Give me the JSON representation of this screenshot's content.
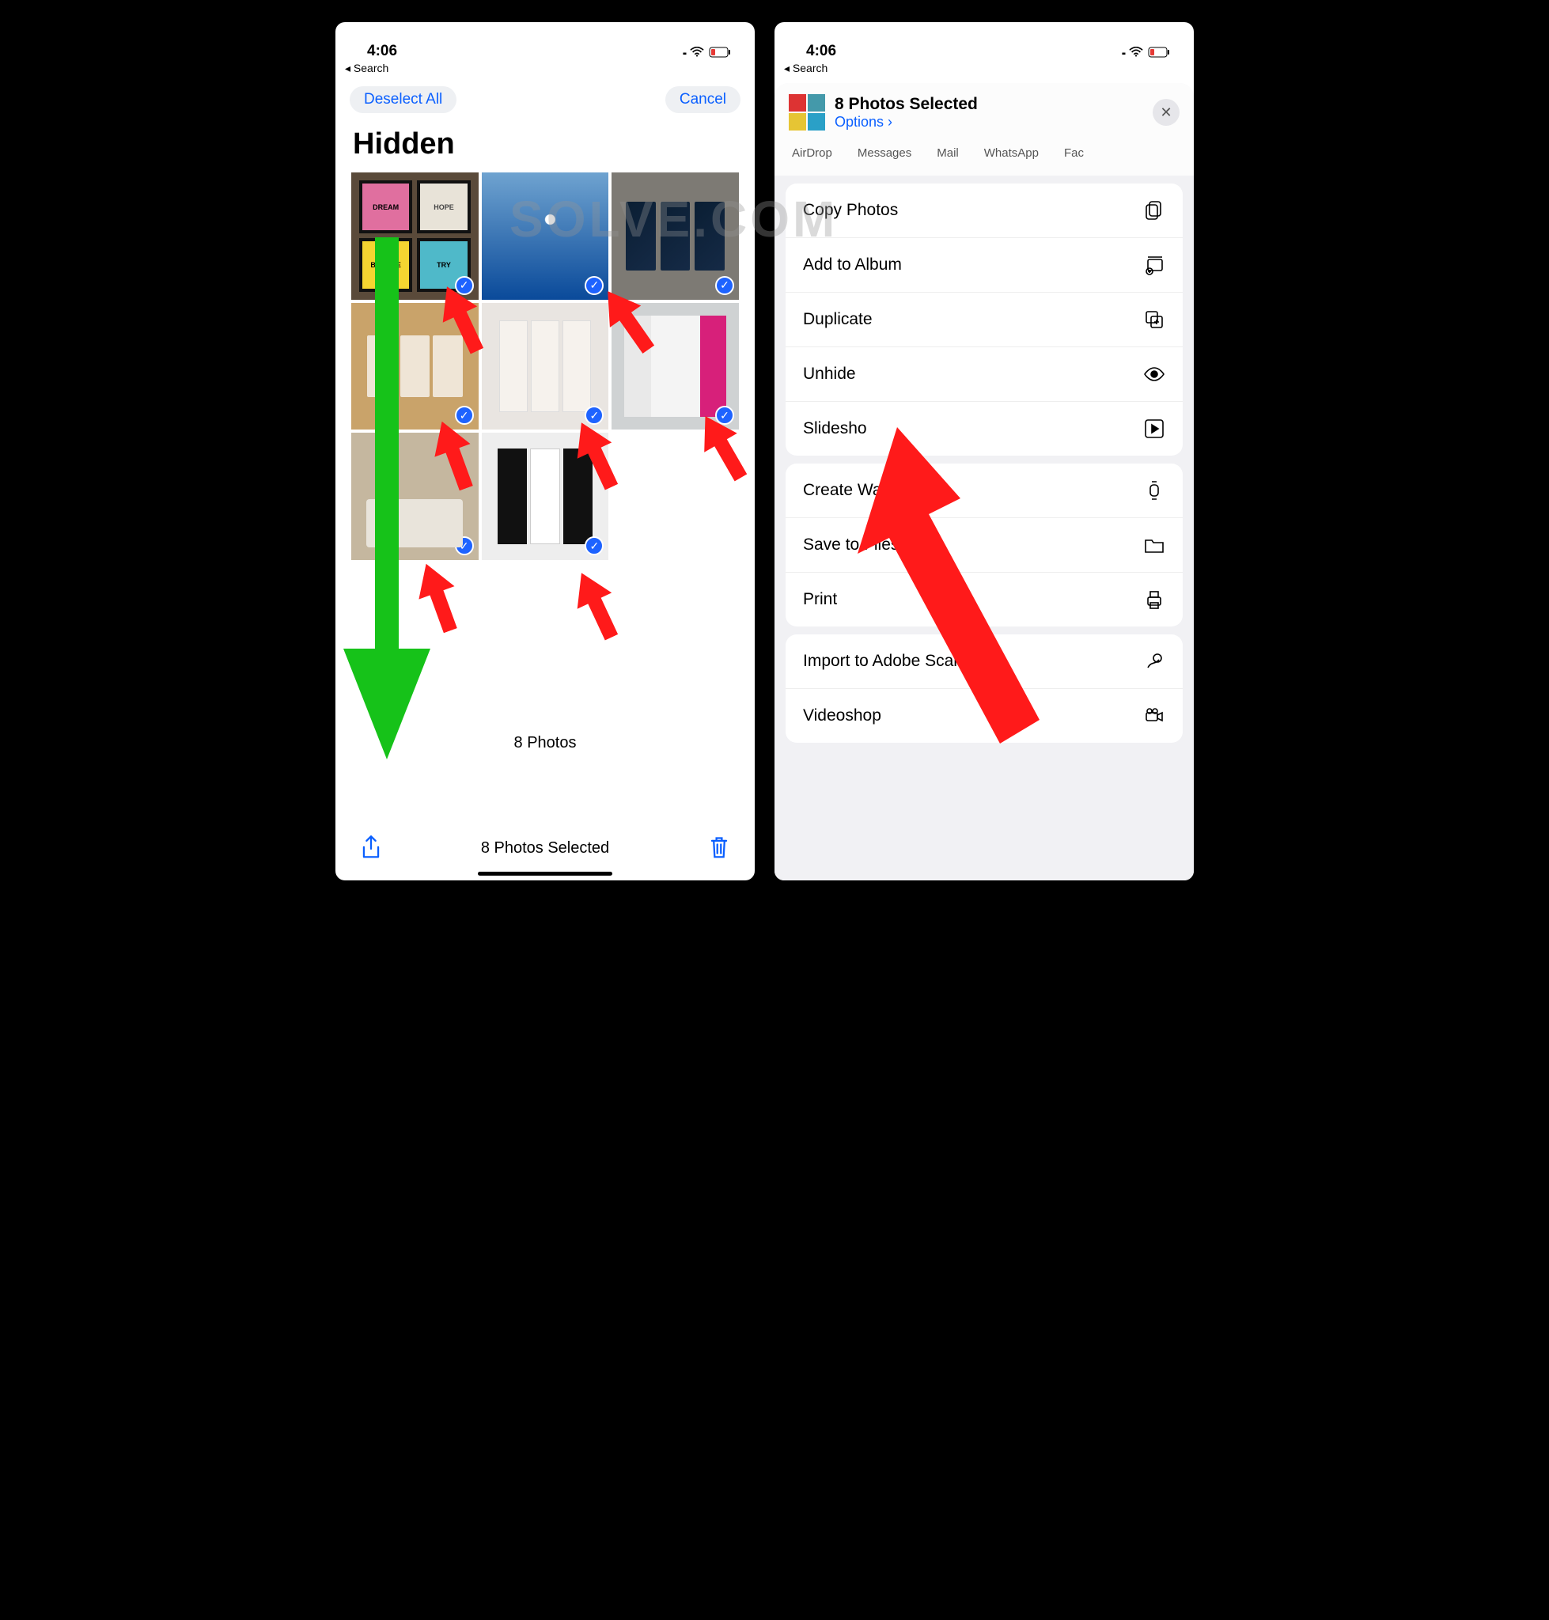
{
  "watermark_text": "SOLVE.COM",
  "status": {
    "time": "4:06"
  },
  "back_label": "Search",
  "left": {
    "deselect": "Deselect All",
    "cancel": "Cancel",
    "title": "Hidden",
    "count_label": "8 Photos",
    "selected_label": "8 Photos Selected",
    "thumbs": {
      "p1": {
        "a": "DREAM",
        "b": "HOPE",
        "c": "BELIEVE",
        "d": "TRY"
      }
    }
  },
  "right": {
    "title": "8 Photos Selected",
    "options": "Options",
    "share_targets": [
      "AirDrop",
      "Messages",
      "Mail",
      "WhatsApp",
      "Fac"
    ],
    "group1": [
      {
        "label": "Copy Photos",
        "icon": "copy"
      },
      {
        "label": "Add to Album",
        "icon": "album"
      },
      {
        "label": "Duplicate",
        "icon": "duplicate"
      },
      {
        "label": "Unhide",
        "icon": "eye"
      },
      {
        "label": "Slidesho",
        "icon": "play"
      }
    ],
    "group2": [
      {
        "label": "Create Watch F",
        "icon": "watch"
      },
      {
        "label": "Save to Files",
        "icon": "folder"
      },
      {
        "label": "Print",
        "icon": "print"
      }
    ],
    "group3": [
      {
        "label": "Import to Adobe Scan",
        "icon": "scan"
      },
      {
        "label": "Videoshop",
        "icon": "video"
      }
    ]
  }
}
